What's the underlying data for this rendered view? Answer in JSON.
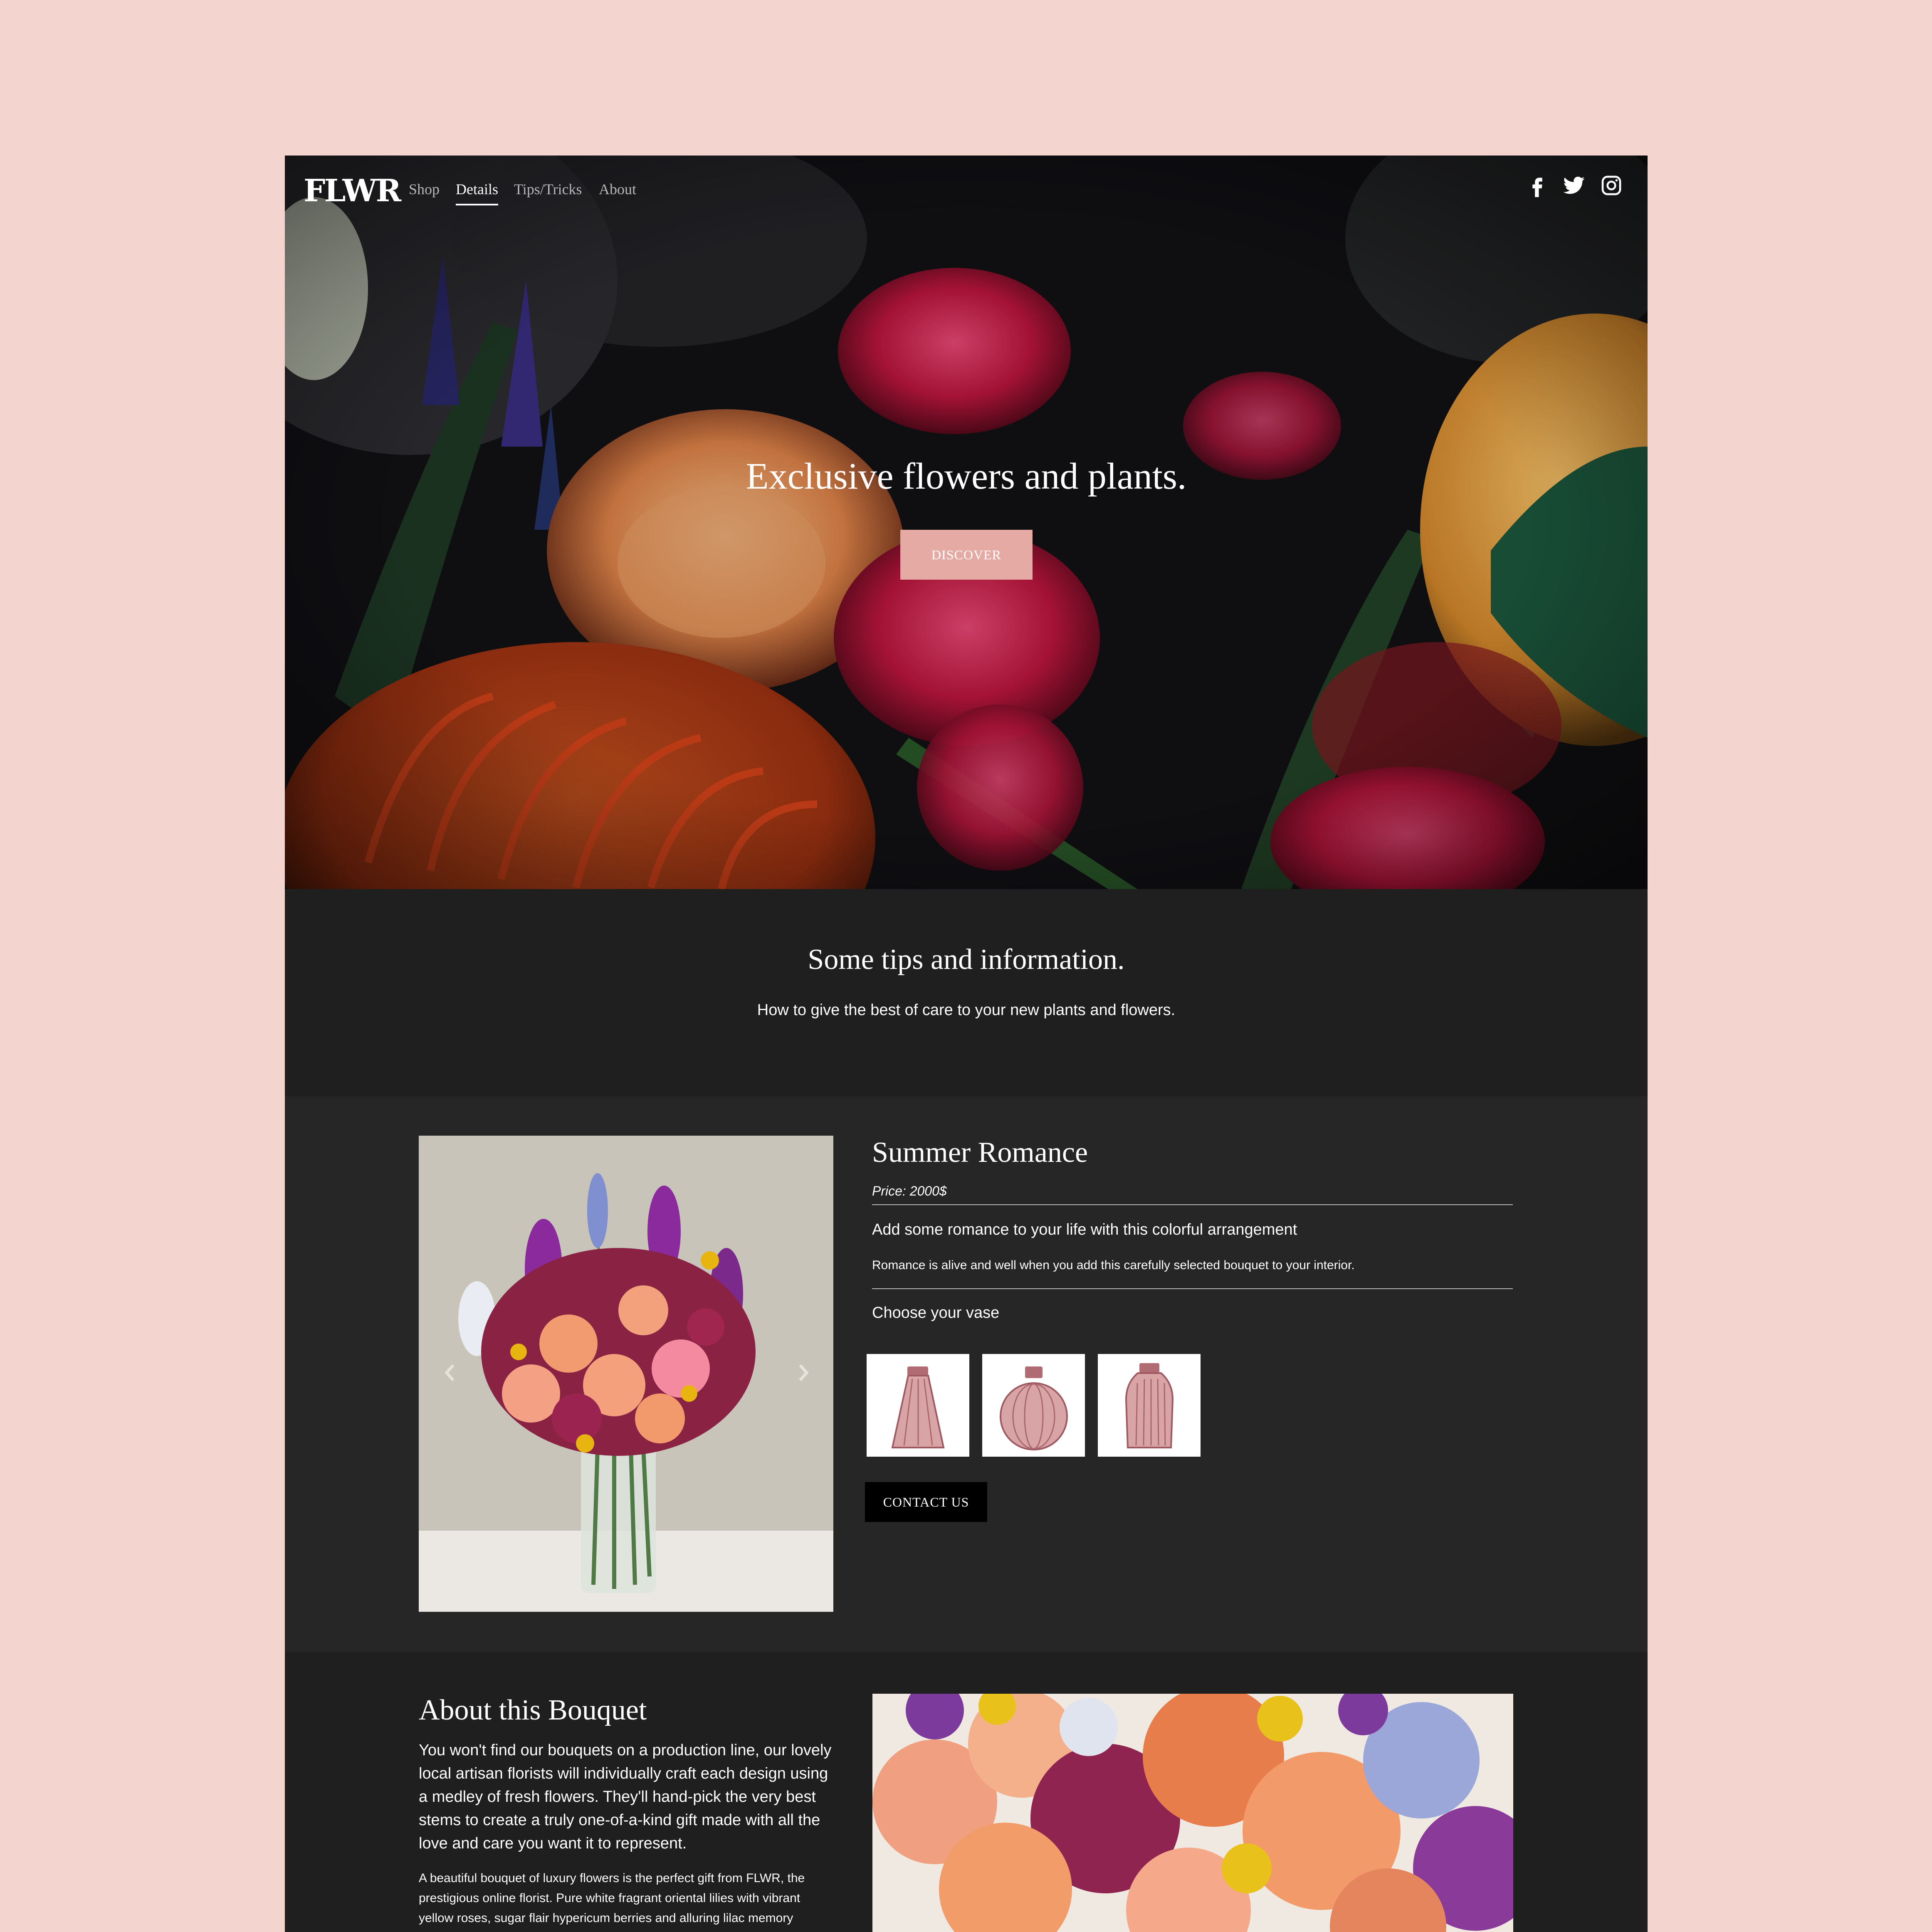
{
  "nav": {
    "logo": "FLWR",
    "links": [
      "Shop",
      "Details",
      "Tips/Tricks",
      "About"
    ],
    "active": "Details",
    "social": [
      "facebook-icon",
      "twitter-icon",
      "instagram-icon"
    ]
  },
  "hero": {
    "title": "Exclusive flowers and plants.",
    "button": "DISCOVER"
  },
  "tips": {
    "title": "Some tips and information.",
    "subtitle": "How to give the best of care to your new plants and flowers."
  },
  "product": {
    "title": "Summer Romance",
    "price": "Price: 2000$",
    "subtitle": "Add some romance to your life with this colorful arrangement",
    "description": "Romance is alive and well when you add this carefully selected bouquet to your interior.",
    "vase_label": "Choose your vase",
    "contact_button": "CONTACT US",
    "carousel_arrows": [
      "chevron-left-icon",
      "chevron-right-icon"
    ]
  },
  "about": {
    "title": "About this Bouquet",
    "paragraph1": "You won't find our bouquets on a production line, our lovely local artisan florists will individually craft each design using a medley of fresh flowers. They'll hand-pick the very best stems to create a truly one-of-a-kind gift made with all the love and care you want it to represent.",
    "paragraph2": "A beautiful bouquet of luxury flowers is the perfect gift from FLWR, the prestigious online florist. Pure white fragrant oriental lilies with vibrant yellow roses, sugar flair hypericum berries and alluring lilac memory"
  },
  "colors": {
    "page_bg": "#f4d4cf",
    "accent": "#e5aaa4",
    "dark": "#242424"
  }
}
